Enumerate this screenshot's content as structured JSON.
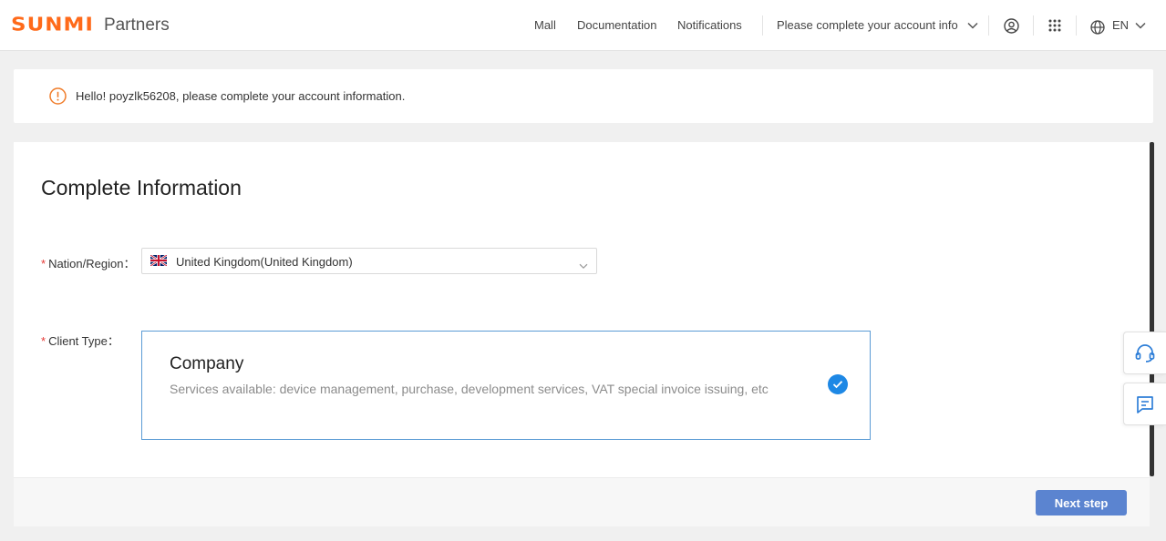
{
  "header": {
    "logo_mark": "SUNMI",
    "logo_text": "Partners",
    "nav": {
      "mall": "Mall",
      "documentation": "Documentation",
      "notifications": "Notifications"
    },
    "account_info": "Please complete your account info",
    "language": "EN",
    "icons": [
      "user-circle-icon",
      "apps-grid-icon",
      "globe-icon",
      "chevron-down-icon"
    ]
  },
  "alert": {
    "icon": "exclamation-circle-icon",
    "message": "Hello! poyzlk56208, please complete your account information.",
    "color": "#f07d2b"
  },
  "form": {
    "title": "Complete Information",
    "nation_label": "Nation/Region：",
    "nation_required": "*",
    "nation_value": "United Kingdom(United Kingdom)",
    "nation_flag": "uk-flag-icon",
    "client_type_label": "Client Type：",
    "client_type_required": "*",
    "client_type": {
      "title": "Company",
      "description": "Services available: device management, purchase, development services, VAT special invoice issuing, etc",
      "selected": true
    },
    "next_button": "Next step"
  },
  "floating": [
    "customer-service-icon",
    "feedback-message-icon"
  ],
  "colors": {
    "brand": "#ff6a1a",
    "accent": "#1e88e5",
    "button": "#5b84d0",
    "required": "#e53935"
  }
}
